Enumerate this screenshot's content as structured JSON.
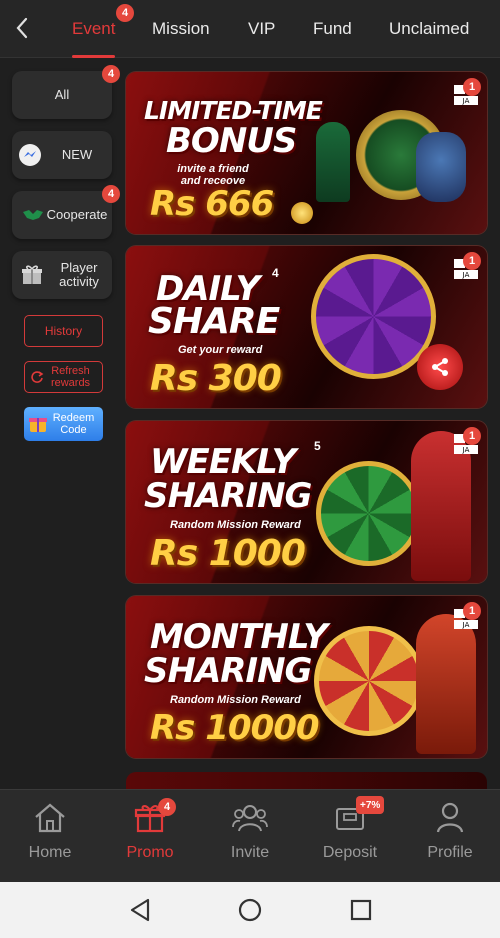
{
  "top_tabs": [
    {
      "label": "Event",
      "badge": "4",
      "active": true
    },
    {
      "label": "Mission"
    },
    {
      "label": "VIP"
    },
    {
      "label": "Fund"
    },
    {
      "label": "Unclaimed"
    }
  ],
  "sidebar": {
    "items": [
      {
        "label": "All",
        "badge": "4",
        "icon": "none"
      },
      {
        "label": "NEW",
        "icon": "messenger-icon"
      },
      {
        "label": "Cooperate",
        "badge": "4",
        "icon": "handshake-icon"
      },
      {
        "label": "Player activity",
        "icon": "gift-box-icon"
      }
    ],
    "history_label": "History",
    "refresh_label": "Refresh rewards",
    "redeem_label": "Redeem Code"
  },
  "banners": [
    {
      "title_line1": "LIMITED-TIME",
      "title_line2": "BONUS",
      "subtitle": "invite a friend and receove",
      "amount": "Rs 666",
      "badge": "1",
      "extra_number": ""
    },
    {
      "title_line1": "DAILY",
      "title_line2": "SHARE",
      "subtitle": "Get your reward",
      "amount": "Rs 300",
      "badge": "1",
      "extra_number": "4"
    },
    {
      "title_line1": "WEEKLY",
      "title_line2": "SHARING",
      "subtitle": "Random Mission Reward",
      "amount": "Rs 1000",
      "badge": "1",
      "extra_number": "5"
    },
    {
      "title_line1": "MONTHLY",
      "title_line2": "SHARING",
      "subtitle": "Random Mission Reward",
      "amount": "Rs 10000",
      "badge": "1",
      "extra_number": ""
    }
  ],
  "bottom_nav": [
    {
      "label": "Home",
      "icon": "home-icon"
    },
    {
      "label": "Promo",
      "icon": "gift-icon",
      "badge": "4",
      "active": true
    },
    {
      "label": "Invite",
      "icon": "people-icon"
    },
    {
      "label": "Deposit",
      "icon": "wallet-icon",
      "badge": "+7%"
    },
    {
      "label": "Profile",
      "icon": "person-icon"
    }
  ],
  "colors": {
    "accent": "#e23a3a",
    "badge": "#e5483d",
    "background": "#1f1f1f",
    "gold": "#ffcf45"
  }
}
